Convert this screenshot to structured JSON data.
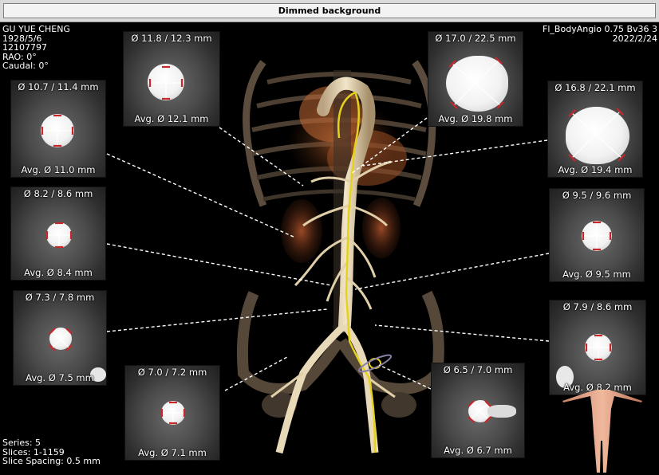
{
  "window": {
    "title": "Dimmed background"
  },
  "patient": {
    "name": "GU YUE CHENG",
    "birth_date": "1928/5/6",
    "id": "12107797",
    "rao": "RAO: 0°",
    "caudal": "Caudal: 0°"
  },
  "study": {
    "protocol": "Fl_BodyAngio  0.75  Bv36  3",
    "date": "2022/2/24"
  },
  "series_info": {
    "series": "Series: 5",
    "slices": "Slices: 1-1159",
    "spacing": "Slice Spacing: 0.5 mm"
  },
  "measurements": [
    {
      "diameters": "Ø 11.8 / 12.3 mm",
      "average": "Avg. Ø 12.1 mm"
    },
    {
      "diameters": "Ø 10.7 / 11.4 mm",
      "average": "Avg. Ø 11.0 mm"
    },
    {
      "diameters": "Ø 8.2 / 8.6 mm",
      "average": "Avg. Ø 8.4 mm"
    },
    {
      "diameters": "Ø 7.3 / 7.8 mm",
      "average": "Avg. Ø 7.5 mm"
    },
    {
      "diameters": "Ø 7.0 / 7.2 mm",
      "average": "Avg. Ø 7.1 mm"
    },
    {
      "diameters": "Ø 17.0 / 22.5 mm",
      "average": "Avg. Ø 19.8 mm"
    },
    {
      "diameters": "Ø 16.8 / 22.1 mm",
      "average": "Avg. Ø 19.4 mm"
    },
    {
      "diameters": "Ø 9.5 / 9.6 mm",
      "average": "Avg. Ø 9.5 mm"
    },
    {
      "diameters": "Ø 7.9 / 8.6 mm",
      "average": "Avg. Ø 8.2 mm"
    },
    {
      "diameters": "Ø 6.5 / 7.0 mm",
      "average": "Avg. Ø 6.7 mm"
    }
  ],
  "colors": {
    "measure_marker": "#c8262b",
    "centerline": "#e6d21a",
    "dashed_leader": "#ffffff",
    "vessel_render": "#e8d9b8",
    "organ_render": "#a0542a"
  },
  "icons": {
    "volume_render": "3d-angiography-render",
    "orientation_figure": "human-body-orientation-icon"
  }
}
